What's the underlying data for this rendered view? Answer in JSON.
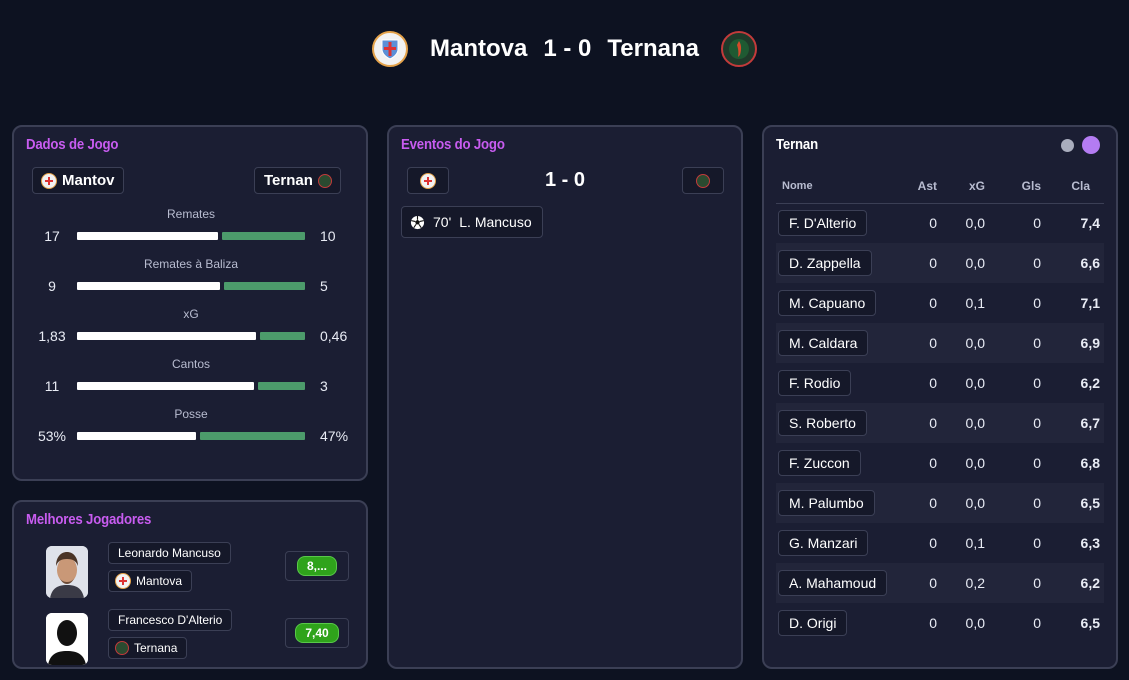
{
  "match": {
    "home_team": "Mantova",
    "away_team": "Ternana",
    "score": "1 - 0",
    "home_crest_icon": "mantova-crest-icon",
    "away_crest_icon": "ternana-crest-icon"
  },
  "game_data": {
    "title": "Dados de Jogo",
    "home_chip": "Mantov",
    "away_chip": "Ternan",
    "stats": [
      {
        "label": "Remates",
        "home": "17",
        "away": "10",
        "home_share": 0.63
      },
      {
        "label": "Remates à Baliza",
        "home": "9",
        "away": "5",
        "home_share": 0.64
      },
      {
        "label": "xG",
        "home": "1,83",
        "away": "0,46",
        "home_share": 0.8
      },
      {
        "label": "Cantos",
        "home": "11",
        "away": "3",
        "home_share": 0.79
      },
      {
        "label": "Posse",
        "home": "53%",
        "away": "47%",
        "home_share": 0.53
      }
    ]
  },
  "best_players": {
    "title": "Melhores Jogadores",
    "players": [
      {
        "name": "Leonardo Mancuso",
        "team": "Mantova",
        "rating": "8,...",
        "avatar_icon": "player-photo-icon"
      },
      {
        "name": "Francesco D'Alterio",
        "team": "Ternana",
        "rating": "7,40",
        "avatar_icon": "player-silhouette-icon"
      }
    ]
  },
  "events": {
    "title": "Eventos do Jogo",
    "score": "1 - 0",
    "items": [
      {
        "icon": "soccer-ball-icon",
        "minute": "70'",
        "player": "L. Mancuso"
      }
    ]
  },
  "roster": {
    "title": "Ternan",
    "columns": [
      "Nome",
      "Ast",
      "xG",
      "Gls",
      "Cla"
    ],
    "rows": [
      {
        "name": "F. D'Alterio",
        "ast": "0",
        "xg": "0,0",
        "gls": "0",
        "cla": "7,4"
      },
      {
        "name": "D. Zappella",
        "ast": "0",
        "xg": "0,0",
        "gls": "0",
        "cla": "6,6"
      },
      {
        "name": "M. Capuano",
        "ast": "0",
        "xg": "0,1",
        "gls": "0",
        "cla": "7,1"
      },
      {
        "name": "M. Caldara",
        "ast": "0",
        "xg": "0,0",
        "gls": "0",
        "cla": "6,9"
      },
      {
        "name": "F. Rodio",
        "ast": "0",
        "xg": "0,0",
        "gls": "0",
        "cla": "6,2"
      },
      {
        "name": "S. Roberto",
        "ast": "0",
        "xg": "0,0",
        "gls": "0",
        "cla": "6,7"
      },
      {
        "name": "F. Zuccon",
        "ast": "0",
        "xg": "0,0",
        "gls": "0",
        "cla": "6,8"
      },
      {
        "name": "M. Palumbo",
        "ast": "0",
        "xg": "0,0",
        "gls": "0",
        "cla": "6,5"
      },
      {
        "name": "G. Manzari",
        "ast": "0",
        "xg": "0,1",
        "gls": "0",
        "cla": "6,3"
      },
      {
        "name": "A. Mahamoud",
        "ast": "0",
        "xg": "0,2",
        "gls": "0",
        "cla": "6,2"
      },
      {
        "name": "D. Origi",
        "ast": "0",
        "xg": "0,0",
        "gls": "0",
        "cla": "6,5"
      }
    ]
  },
  "colors": {
    "accent": "#c85cf0",
    "bar_home": "#ffffff",
    "bar_away": "#4c9b6b",
    "rating_green": "#2fa31b",
    "page_bg": "#0d1221",
    "panel_bg": "#1b1e33",
    "toggle_inactive": "#a9adbd",
    "toggle_active": "#b47cf2"
  }
}
